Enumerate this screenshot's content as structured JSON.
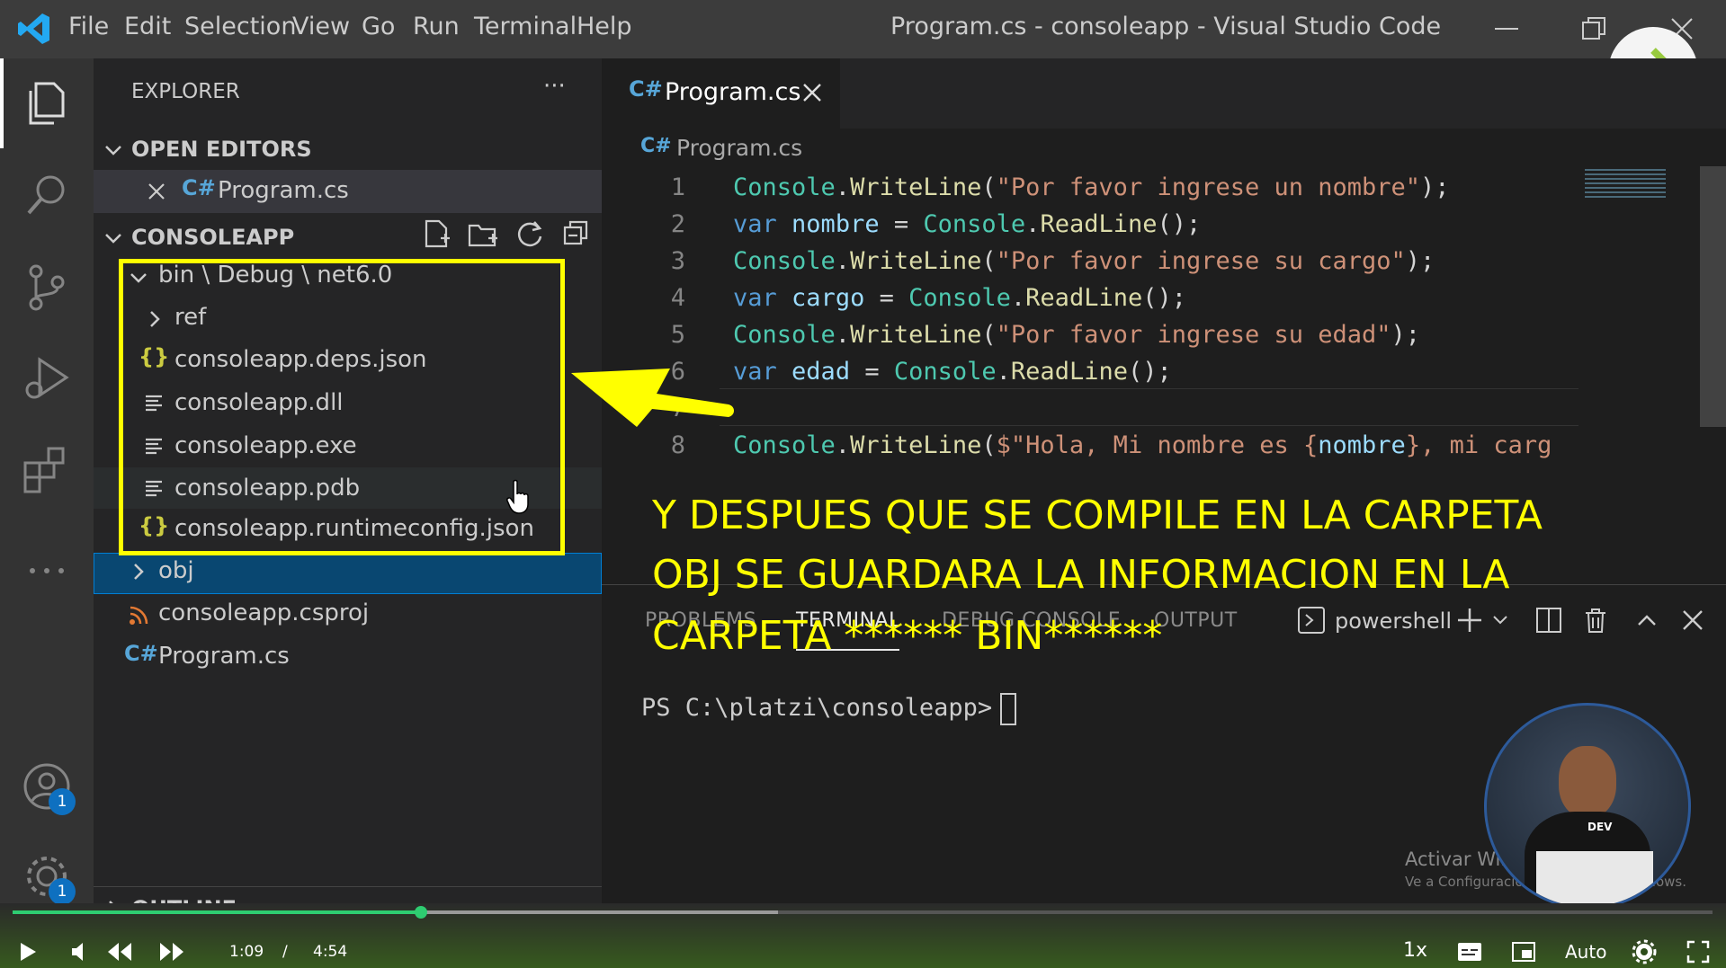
{
  "titlebar": {
    "menu": [
      "File",
      "Edit",
      "Selection",
      "View",
      "Go",
      "Run",
      "Terminal",
      "Help"
    ],
    "window_title": "Program.cs - consoleapp - Visual Studio Code"
  },
  "activity_bar": {
    "account_badge": "1",
    "settings_badge": "1"
  },
  "sidebar": {
    "title": "EXPLORER",
    "more": "···",
    "open_editors_header": "OPEN EDITORS",
    "open_editor_file": "Program.cs",
    "project_header": "CONSOLEAPP",
    "folder_path": "bin \\ Debug \\ net6.0",
    "tree": {
      "ref": "ref",
      "deps_json": "consoleapp.deps.json",
      "dll": "consoleapp.dll",
      "exe": "consoleapp.exe",
      "pdb": "consoleapp.pdb",
      "runtimeconfig": "consoleapp.runtimeconfig.json",
      "obj": "obj",
      "csproj": "consoleapp.csproj",
      "program": "Program.cs"
    },
    "outline_header": "OUTLINE"
  },
  "editor": {
    "tab_label": "Program.cs",
    "breadcrumb": "Program.cs",
    "line_numbers": [
      "1",
      "2",
      "3",
      "4",
      "5",
      "6",
      "7",
      "8"
    ],
    "lines": {
      "l1": {
        "a": "Console",
        "b": ".",
        "c": "WriteLine",
        "d": "(",
        "e": "\"Por favor ingrese un nombre\"",
        "f": ");"
      },
      "l2": {
        "a": "var",
        "b": " ",
        "c": "nombre",
        "d": " = ",
        "e": "Console",
        "f": ".",
        "g": "ReadLine",
        "h": "();"
      },
      "l3": {
        "a": "Console",
        "b": ".",
        "c": "WriteLine",
        "d": "(",
        "e": "\"Por favor ingrese su cargo\"",
        "f": ");"
      },
      "l4": {
        "a": "var",
        "b": " ",
        "c": "cargo",
        "d": " = ",
        "e": "Console",
        "f": ".",
        "g": "ReadLine",
        "h": "();"
      },
      "l5": {
        "a": "Console",
        "b": ".",
        "c": "WriteLine",
        "d": "(",
        "e": "\"Por favor ingrese su edad\"",
        "f": ");"
      },
      "l6": {
        "a": "var",
        "b": " ",
        "c": "edad",
        "d": " = ",
        "e": "Console",
        "f": ".",
        "g": "ReadLine",
        "h": "();"
      },
      "l8": {
        "a": "Console",
        "b": ".",
        "c": "WriteLine",
        "d": "(",
        "e": "$\"Hola, Mi nombre es {",
        "f": "nombre",
        "g": "}, mi carg"
      }
    }
  },
  "panel": {
    "tabs": [
      "PROBLEMS",
      "TERMINAL",
      "DEBUG CONSOLE",
      "OUTPUT"
    ],
    "terminal_name": "powershell",
    "prompt": "PS C:\\platzi\\consoleapp>"
  },
  "annotation": {
    "line1": "Y DESPUES QUE SE COMPILE EN LA CARPETA",
    "line2": "OBJ  SE GUARDARA LA INFORMACION EN LA",
    "line3": "CARPETA      ****** BIN******"
  },
  "watermark": {
    "line1": "Activar Windows",
    "line2": "Ve a Configuración para activar Windows."
  },
  "webcam": {
    "shirt_label": "DEV"
  },
  "player": {
    "current_time": "1:09",
    "separator": "/",
    "duration": "4:54",
    "speed": "1x",
    "quality": "Auto",
    "progress": 0.24,
    "buffered": 0.45
  },
  "colors": {
    "accent_blue": "#0e70c0",
    "annotation_yellow": "#ffff00",
    "progress_green": "#2ecc71"
  }
}
